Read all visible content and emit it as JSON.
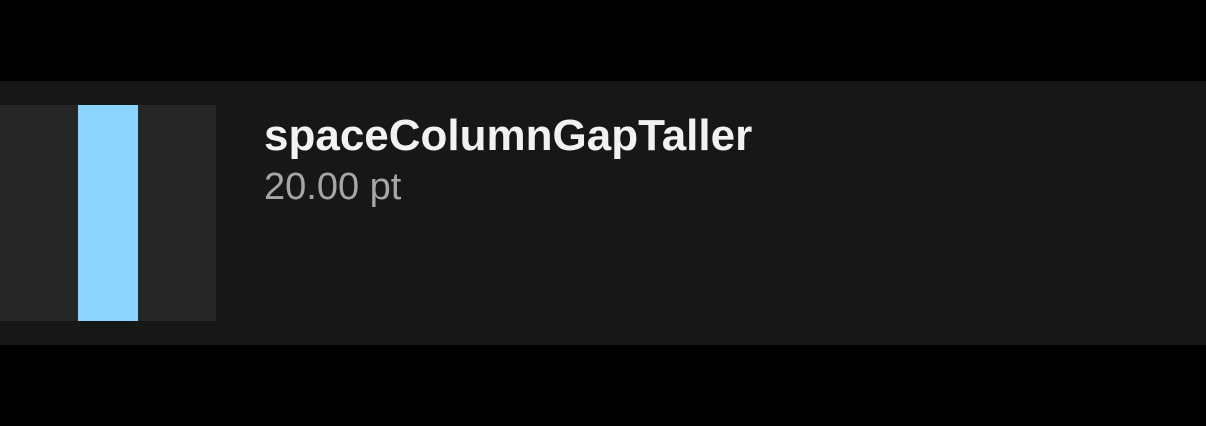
{
  "token": {
    "name": "spaceColumnGapTaller",
    "value": "20.00 pt"
  },
  "colors": {
    "background": "#000000",
    "row": "#171717",
    "preview": "#262626",
    "gap_bar": "#8AD4FF",
    "name_text": "#F2F2F2",
    "value_text": "#A6A6A6"
  }
}
